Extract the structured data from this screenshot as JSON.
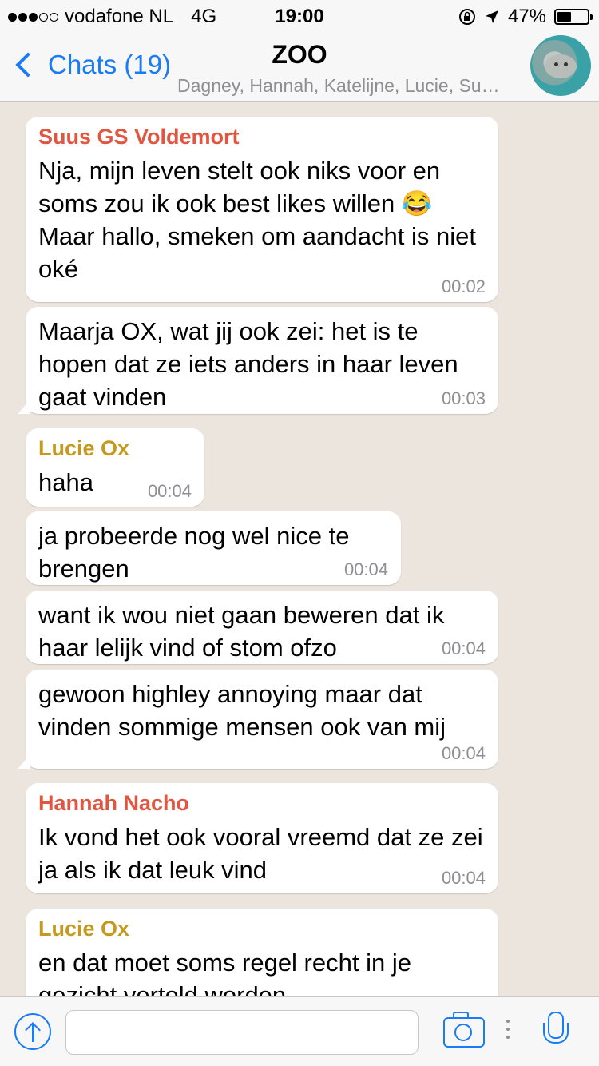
{
  "status_bar": {
    "carrier": "vodafone NL",
    "network": "4G",
    "time": "19:00",
    "battery_text": "47%",
    "battery_level": 0.47,
    "signal_bars_filled": 3,
    "signal_bars_total": 5,
    "icons": [
      "orientation-lock-icon",
      "location-arrow-icon",
      "battery-icon"
    ]
  },
  "header": {
    "back_label": "Chats (19)",
    "title": "ZOO",
    "subtitle": "Dagney, Hannah, Katelijne, Lucie, Su…",
    "avatar_icon": "group-avatar-manatee"
  },
  "messages": [
    {
      "sender": "Suus GS Voldemort",
      "text": "Nja, mijn leven stelt ook niks voor en soms zou ik ook best likes willen 😂 Maar hallo, smeken om aandacht is niet oké",
      "time": "00:02"
    },
    {
      "sender": "",
      "text": "Maarja OX, wat jij ook zei: het is te hopen dat ze iets anders in haar leven gaat vinden",
      "time": "00:03"
    },
    {
      "sender": "Lucie Ox",
      "text": "haha",
      "time": "00:04"
    },
    {
      "sender": "",
      "text": "ja probeerde nog wel nice te brengen",
      "time": "00:04"
    },
    {
      "sender": "",
      "text": "want ik wou niet gaan beweren dat ik haar lelijk vind of stom ofzo",
      "time": "00:04"
    },
    {
      "sender": "",
      "text": "gewoon highley annoying maar dat vinden sommige mensen ook van mij",
      "time": "00:04"
    },
    {
      "sender": "Hannah Nacho",
      "text": "Ik vond het ook vooral vreemd dat ze zei ja als ik dat leuk vind",
      "time": "00:04"
    },
    {
      "sender": "Lucie Ox",
      "text": "en dat moet soms regel recht in je gezicht verteld worden",
      "time": ""
    }
  ],
  "input_bar": {
    "placeholder": "",
    "icons": [
      "share-icon",
      "camera-icon",
      "microphone-icon"
    ]
  },
  "colors": {
    "accent": "#1a7cf5",
    "sender_red": "#e05640",
    "sender_gold": "#c49a1e",
    "chat_background": "#ece5dd"
  }
}
